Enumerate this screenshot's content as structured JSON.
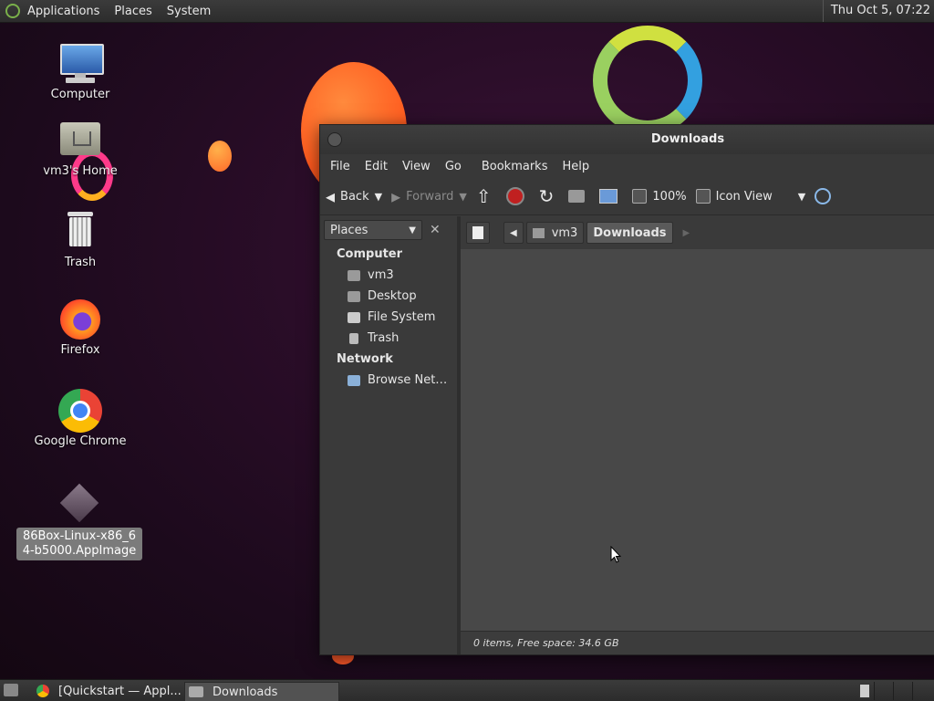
{
  "top_panel": {
    "menus": [
      "Applications",
      "Places",
      "System"
    ],
    "clock": "Thu Oct  5, 07:22"
  },
  "desktop_icons": [
    {
      "label": "Computer"
    },
    {
      "label": "vm3's Home"
    },
    {
      "label": "Trash"
    },
    {
      "label": "Firefox"
    },
    {
      "label": "Google Chrome"
    },
    {
      "label": "86Box-Linux-x86_64-b5000.AppImage"
    }
  ],
  "window": {
    "title": "Downloads",
    "menubar": [
      "File",
      "Edit",
      "View",
      "Go",
      "Bookmarks",
      "Help"
    ],
    "toolbar": {
      "back": "Back",
      "forward": "Forward",
      "zoom": "100%",
      "view_mode": "Icon View"
    },
    "sidebar": {
      "selector": "Places",
      "sections": [
        {
          "heading": "Computer",
          "items": [
            "vm3",
            "Desktop",
            "File System",
            "Trash"
          ]
        },
        {
          "heading": "Network",
          "items": [
            "Browse Net…"
          ]
        }
      ]
    },
    "pathbar": [
      "vm3",
      "Downloads"
    ],
    "status": "0 items, Free space: 34.6 GB"
  },
  "taskbar": [
    {
      "label": "[Quickstart — Appl..."
    },
    {
      "label": "Downloads"
    }
  ]
}
